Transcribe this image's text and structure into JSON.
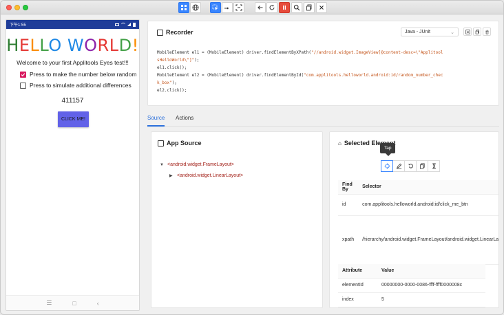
{
  "device": {
    "status_time": "下午1:55",
    "hello_letters": [
      {
        "ch": "H",
        "color": "#2e7d32"
      },
      {
        "ch": "E",
        "color": "#e53935"
      },
      {
        "ch": "L",
        "color": "#fb8c00"
      },
      {
        "ch": "L",
        "color": "#43a047"
      },
      {
        "ch": "O",
        "color": "#1e88e5"
      },
      {
        "ch": " ",
        "color": "#000000"
      },
      {
        "ch": "W",
        "color": "#1e88e5"
      },
      {
        "ch": "O",
        "color": "#8e24aa"
      },
      {
        "ch": "R",
        "color": "#e53935"
      },
      {
        "ch": "L",
        "color": "#e53935"
      },
      {
        "ch": "D",
        "color": "#43a047"
      },
      {
        "ch": "!",
        "color": "#fb8c00"
      }
    ],
    "welcome": "Welcome to your first Applitools Eyes test!!!",
    "checkbox1": "Press to make the number below random",
    "checkbox2": "Press to simulate additional differences",
    "number": "411157",
    "button": "CLICK ME!"
  },
  "recorder": {
    "title": "Recorder",
    "language": "Java - JUnit",
    "code": {
      "l1a": "MobileElement el1 = (MobileElement) driver.findElementByXPath(",
      "l1b": "\"//android.widget.ImageView[@content-desc=\\\"Applitool",
      "l2": "sHelloWorld\\\"]\"",
      "l2b": ");",
      "l3": "el1.click();",
      "l4a": "MobileElement el2 = (MobileElement) driver.findElementById(",
      "l4b": "\"com.applitools.helloworld.android:id/random_number_chec",
      "l5": "k_box\"",
      "l5b": ");",
      "l6": "el2.click();"
    }
  },
  "tabs": {
    "source": "Source",
    "actions": "Actions"
  },
  "source": {
    "title": "App Source",
    "node1": "<android.widget.FrameLayout>",
    "node2": "<android.widget.LinearLayout>"
  },
  "selected": {
    "title": "Selected Element",
    "tooltip": "Tap",
    "findby_header": "Find By",
    "selector_header": "Selector",
    "rows": [
      {
        "k": "id",
        "v": "com.applitools.helloworld.android:id/click_me_btn"
      },
      {
        "k": "xpath",
        "v": "/hierarchy/android.widget.FrameLayout/android.widget.LinearLayout/android.widget.FrameLayout/android.widget.LinearLayout/android.widget.FrameLayout/android.view.ViewGroup/android.widget.Button"
      }
    ],
    "attr_header": "Attribute",
    "value_header": "Value",
    "attrs": [
      {
        "k": "elementId",
        "v": "00000000-0000-0086-ffff-ffff0000008c"
      },
      {
        "k": "index",
        "v": "5"
      }
    ]
  }
}
